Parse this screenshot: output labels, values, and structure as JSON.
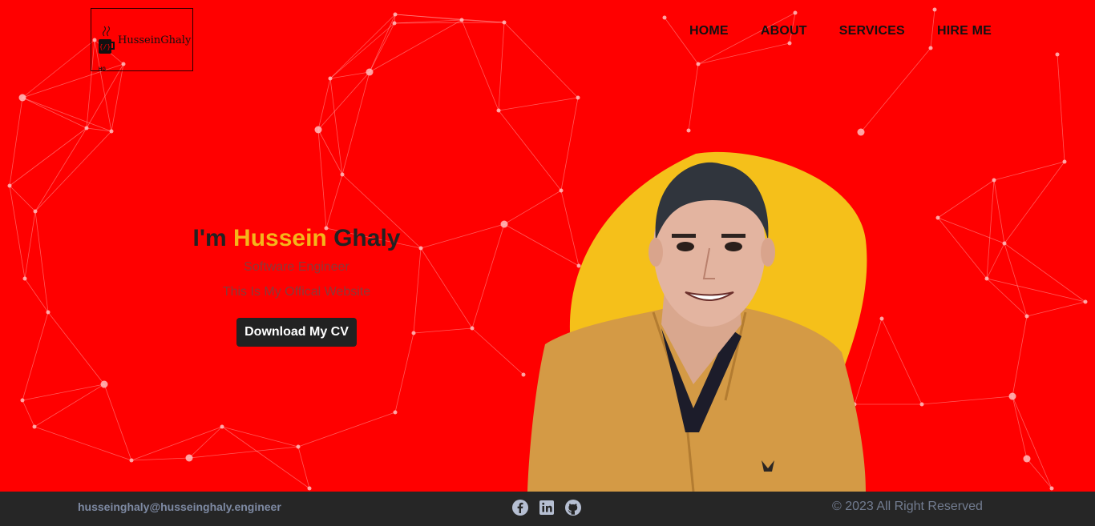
{
  "brand": {
    "name": "HusseinGhaly",
    "small": "HG"
  },
  "nav": [
    {
      "label": "HOME"
    },
    {
      "label": "ABOUT"
    },
    {
      "label": "SERVICES"
    },
    {
      "label": "HIRE ME"
    }
  ],
  "hero": {
    "intro": "I'm",
    "first_name": "Hussein",
    "last_name": "Ghaly",
    "subtitle": "Software Engineer",
    "tagline": "This Is My Offical Website",
    "cv_button": "Download My CV"
  },
  "footer": {
    "email": "husseinghaly@husseinghaly.engineer",
    "social": [
      "facebook-icon",
      "linkedin-icon",
      "github-icon"
    ],
    "copyright": "© 2023 All Right Reserved"
  },
  "colors": {
    "background": "#ff0000",
    "accent": "#f5b51a",
    "footer": "#262626",
    "button": "#222222"
  }
}
